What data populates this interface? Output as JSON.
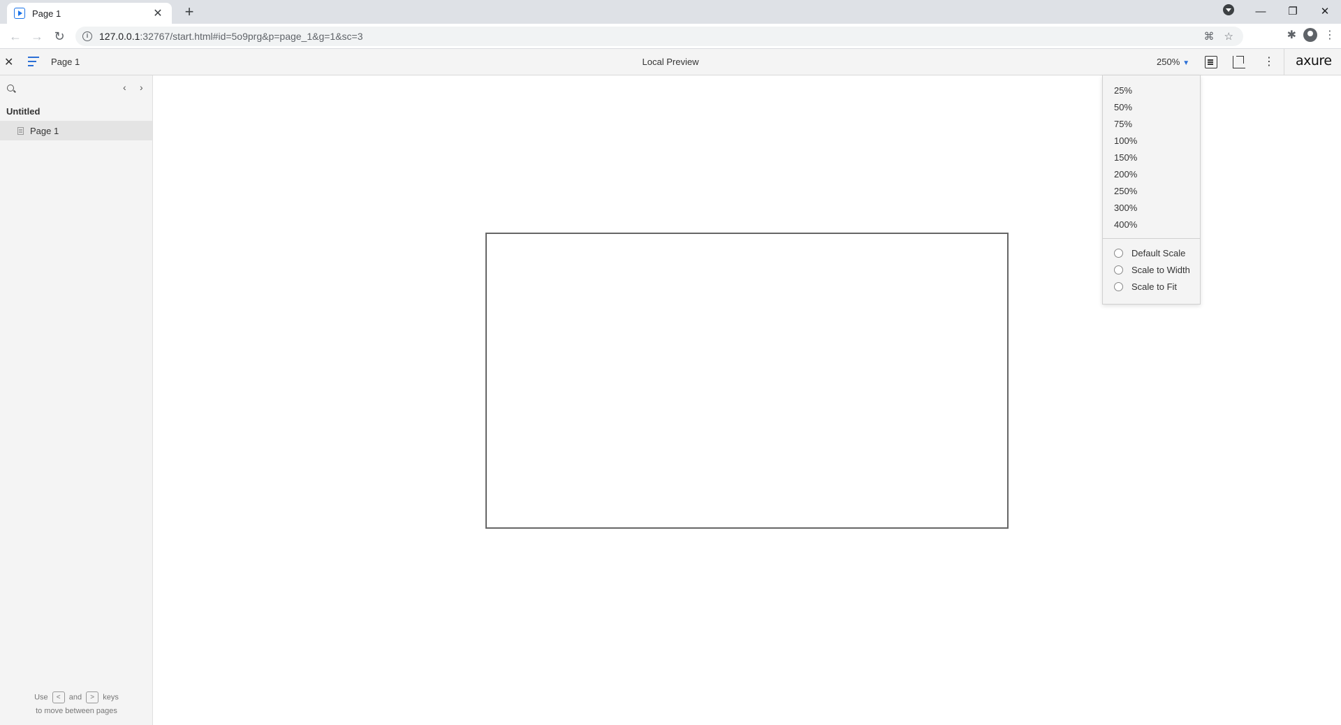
{
  "browser": {
    "tab_title": "Page 1",
    "url_host": "127.0.0.1",
    "url_rest": ":32767/start.html#id=5o9prg&p=page_1&g=1&sc=3"
  },
  "axure": {
    "page_name": "Page 1",
    "preview_label": "Local Preview",
    "zoom_value": "250%",
    "logo": "axure"
  },
  "sidebar": {
    "project": "Untitled",
    "pages": [
      {
        "label": "Page 1",
        "selected": true
      }
    ],
    "hint_use": "Use",
    "hint_and": "and",
    "hint_keys": "keys",
    "hint_line2": "to move between pages"
  },
  "zoom_menu": {
    "options": [
      "25%",
      "50%",
      "75%",
      "100%",
      "150%",
      "200%",
      "250%",
      "300%",
      "400%"
    ],
    "scale_options": [
      "Default Scale",
      "Scale to Width",
      "Scale to Fit"
    ]
  },
  "colors": {
    "accent": "#2b6fd6",
    "chrome_tabstrip": "#dee1e6",
    "panel": "#f4f4f4"
  },
  "icons": [
    "play-favicon-icon",
    "close-icon",
    "plus-icon",
    "back-arrow-icon",
    "forward-arrow-icon",
    "reload-icon",
    "info-icon",
    "translate-icon",
    "star-icon",
    "puzzle-icon",
    "profile-icon",
    "kebab-icon",
    "hamburger-icon",
    "search-icon",
    "chevron-left-icon",
    "chevron-right-icon",
    "notes-icon",
    "inspect-icon",
    "chevron-down-icon",
    "page-icon"
  ]
}
